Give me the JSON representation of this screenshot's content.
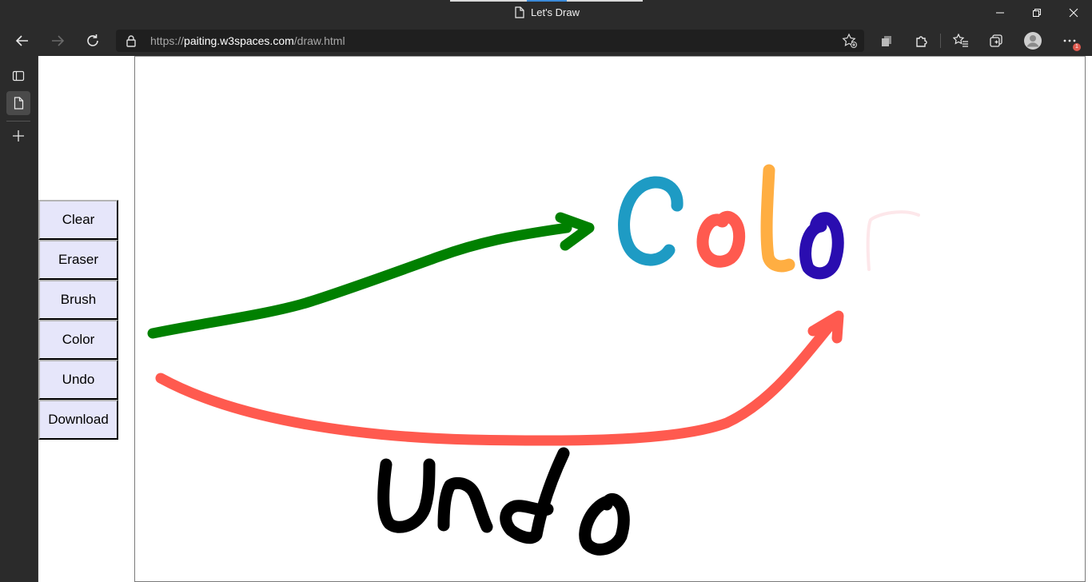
{
  "window": {
    "title": "Let's Draw",
    "controls": [
      "minimize-icon",
      "restore-icon",
      "close-icon"
    ]
  },
  "toolbar": {
    "url_prefix": "https://",
    "url_host": "paiting.w3spaces.com",
    "url_path": "/draw.html",
    "extensions_badge": "1"
  },
  "sidebar": {
    "items": [
      {
        "icon": "tab-actions-icon"
      },
      {
        "icon": "page-icon",
        "selected": true
      },
      {
        "icon": "new-tab-icon"
      }
    ]
  },
  "tools": {
    "clear": "Clear",
    "eraser": "Eraser",
    "brush": "Brush",
    "color": "Color",
    "undo": "Undo",
    "download": "Download"
  },
  "canvas": {
    "strokes": [
      {
        "name": "green-arrow",
        "color": "#008000"
      },
      {
        "name": "red-arrow",
        "color": "#ff5a4f"
      },
      {
        "name": "letter-C",
        "color": "#1e9bc4"
      },
      {
        "name": "letter-o-red",
        "color": "#ff5a4f"
      },
      {
        "name": "letter-l",
        "color": "#ffae42"
      },
      {
        "name": "letter-o-blue",
        "color": "#2a0db0"
      },
      {
        "name": "letter-r-faint",
        "color": "#fde7ea"
      },
      {
        "name": "word-undo",
        "color": "#000000"
      }
    ]
  }
}
